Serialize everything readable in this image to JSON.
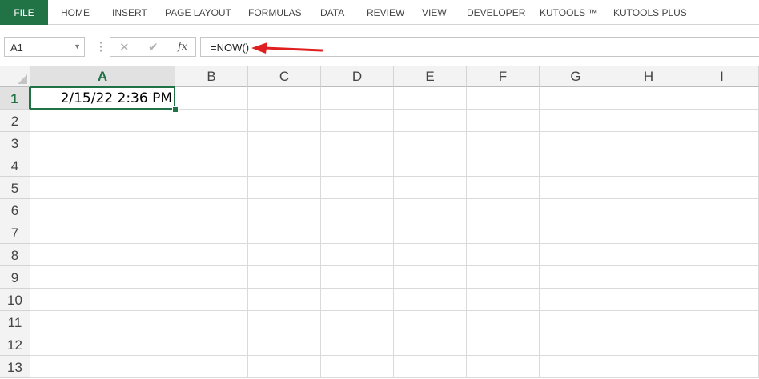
{
  "ribbon": {
    "tabs": [
      {
        "label": "FILE"
      },
      {
        "label": "HOME"
      },
      {
        "label": "INSERT"
      },
      {
        "label": "PAGE LAYOUT"
      },
      {
        "label": "FORMULAS"
      },
      {
        "label": "DATA"
      },
      {
        "label": "REVIEW"
      },
      {
        "label": "VIEW"
      },
      {
        "label": "DEVELOPER"
      },
      {
        "label": "KUTOOLS ™"
      },
      {
        "label": "KUTOOLS PLUS"
      }
    ]
  },
  "formula_bar": {
    "name_box": "A1",
    "cancel_icon": "✕",
    "enter_icon": "✔",
    "fx_label": "fx",
    "formula": "=NOW()",
    "arrow_color": "#e02020"
  },
  "sheet": {
    "columns": [
      "A",
      "B",
      "C",
      "D",
      "E",
      "F",
      "G",
      "H",
      "I"
    ],
    "rows": [
      "1",
      "2",
      "3",
      "4",
      "5",
      "6",
      "7",
      "8",
      "9",
      "10",
      "11",
      "12",
      "13"
    ],
    "cells": {
      "A1": "2/15/22 2:36 PM"
    },
    "accent": "#217346"
  }
}
